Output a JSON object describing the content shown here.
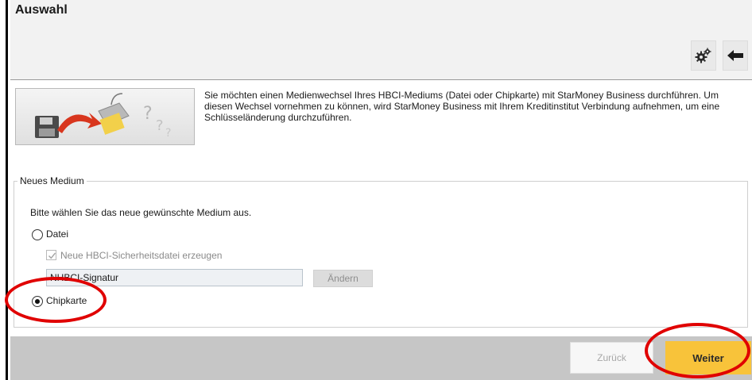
{
  "window": {
    "title": "Auswahl"
  },
  "toolbar": {
    "settings_icon": "gears-icon",
    "back_icon": "arrow-left-icon"
  },
  "intro": {
    "text": "Sie möchten einen Medienwechsel Ihres HBCI-Mediums (Datei oder Chipkarte) mit StarMoney Business durchführen. Um diesen Wechsel vornehmen zu können, wird StarMoney Business mit Ihrem Kreditinstitut Verbindung aufnehmen, um eine Schlüsseländerung durchzuführen."
  },
  "group": {
    "legend": "Neues Medium",
    "instruction": "Bitte wählen Sie das neue gewünschte Medium aus.",
    "option_datei": {
      "label": "Datei",
      "selected": false
    },
    "checkbox": {
      "label": "Neue HBCI-Sicherheitsdatei erzeugen",
      "checked": true,
      "disabled": true
    },
    "file_input": {
      "value": "NHBCI-Signatur"
    },
    "aendern_button": "Ändern",
    "option_chipkarte": {
      "label": "Chipkarte",
      "selected": true
    }
  },
  "footer": {
    "back_button": "Zurück",
    "next_button": "Weiter"
  },
  "colors": {
    "accent": "#f8c33a",
    "annotation": "#e00000",
    "footer": "#c6c6c6"
  }
}
